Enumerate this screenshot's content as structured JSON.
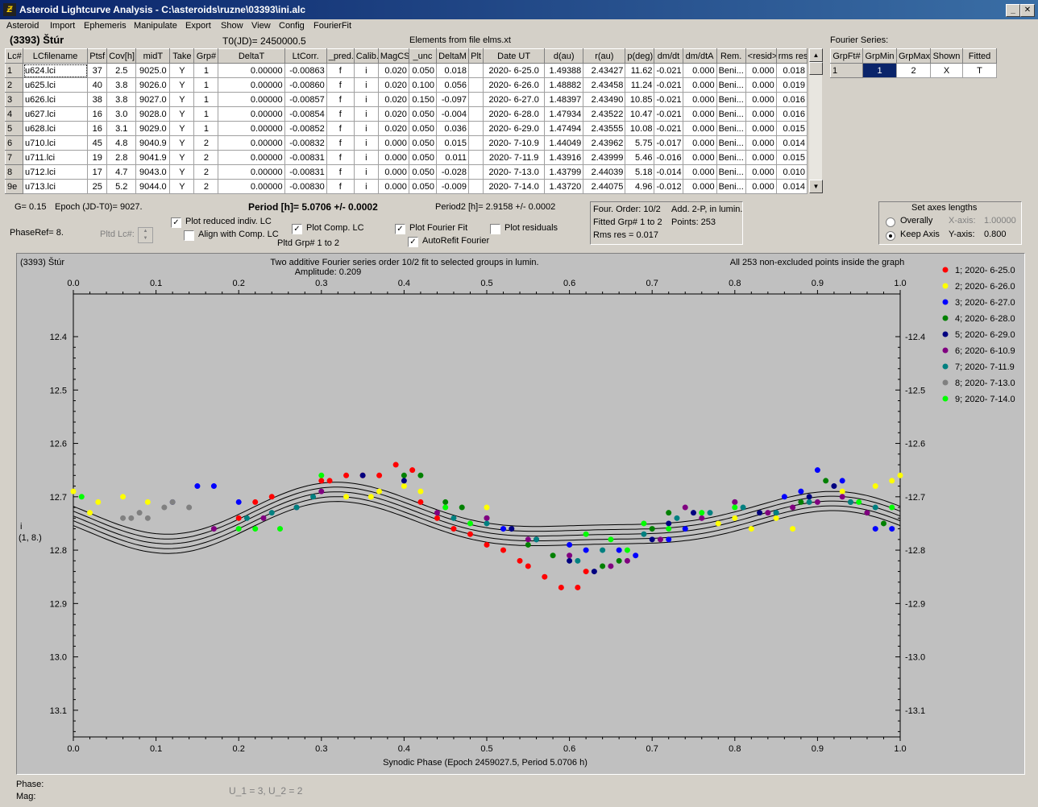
{
  "window": {
    "title": "Asteroid Lightcurve Analysis - C:\\asteroids\\ruzne\\03393\\ini.alc",
    "app_icon": "app-icon"
  },
  "menu": [
    "Asteroid",
    "Import",
    "Ephemeris",
    "Manipulate",
    "Export",
    "Show",
    "View",
    "Config",
    "FourierFit"
  ],
  "header": {
    "asteroid": "(3393) Štúr",
    "t0": "T0(JD)= 2450000.5",
    "elements": "Elements from file elms.xt"
  },
  "table": {
    "columns": [
      "Lc#",
      "LCfilename",
      "Ptsf",
      "Cov[h]",
      "midT",
      "Take",
      "Grp#",
      "DeltaT",
      "LtCorr.",
      "_pred.",
      "Calib.",
      "MagCS",
      "_unc",
      "DeltaM",
      "Plt",
      "Date UT",
      "d(au)",
      "r(au)",
      "p(deg)",
      "dm/dt",
      "dm/dtA",
      "Rem.",
      "<resid>",
      "rms res"
    ],
    "rows": [
      [
        "1",
        "u624.lci",
        "37",
        "2.5",
        "9025.0",
        "Y",
        "1",
        "0.00000",
        "-0.00863",
        "f",
        "i",
        "0.020",
        "0.050",
        "0.018",
        "",
        "2020- 6-25.0",
        "1.49388",
        "2.43427",
        "11.62",
        "-0.021",
        "0.000",
        "Beni...",
        "0.000",
        "0.018"
      ],
      [
        "2",
        "u625.lci",
        "40",
        "3.8",
        "9026.0",
        "Y",
        "1",
        "0.00000",
        "-0.00860",
        "f",
        "i",
        "0.020",
        "0.100",
        "0.056",
        "",
        "2020- 6-26.0",
        "1.48882",
        "2.43458",
        "11.24",
        "-0.021",
        "0.000",
        "Beni...",
        "0.000",
        "0.019"
      ],
      [
        "3",
        "u626.lci",
        "38",
        "3.8",
        "9027.0",
        "Y",
        "1",
        "0.00000",
        "-0.00857",
        "f",
        "i",
        "0.020",
        "0.150",
        "-0.097",
        "",
        "2020- 6-27.0",
        "1.48397",
        "2.43490",
        "10.85",
        "-0.021",
        "0.000",
        "Beni...",
        "0.000",
        "0.016"
      ],
      [
        "4",
        "u627.lci",
        "16",
        "3.0",
        "9028.0",
        "Y",
        "1",
        "0.00000",
        "-0.00854",
        "f",
        "i",
        "0.020",
        "0.050",
        "-0.004",
        "",
        "2020- 6-28.0",
        "1.47934",
        "2.43522",
        "10.47",
        "-0.021",
        "0.000",
        "Beni...",
        "0.000",
        "0.016"
      ],
      [
        "5",
        "u628.lci",
        "16",
        "3.1",
        "9029.0",
        "Y",
        "1",
        "0.00000",
        "-0.00852",
        "f",
        "i",
        "0.020",
        "0.050",
        "0.036",
        "",
        "2020- 6-29.0",
        "1.47494",
        "2.43555",
        "10.08",
        "-0.021",
        "0.000",
        "Beni...",
        "0.000",
        "0.015"
      ],
      [
        "6",
        "u710.lci",
        "45",
        "4.8",
        "9040.9",
        "Y",
        "2",
        "0.00000",
        "-0.00832",
        "f",
        "i",
        "0.000",
        "0.050",
        "0.015",
        "",
        "2020- 7-10.9",
        "1.44049",
        "2.43962",
        "5.75",
        "-0.017",
        "0.000",
        "Beni...",
        "0.000",
        "0.014"
      ],
      [
        "7",
        "u711.lci",
        "19",
        "2.8",
        "9041.9",
        "Y",
        "2",
        "0.00000",
        "-0.00831",
        "f",
        "i",
        "0.000",
        "0.050",
        "0.011",
        "",
        "2020- 7-11.9",
        "1.43916",
        "2.43999",
        "5.46",
        "-0.016",
        "0.000",
        "Beni...",
        "0.000",
        "0.015"
      ],
      [
        "8",
        "u712.lci",
        "17",
        "4.7",
        "9043.0",
        "Y",
        "2",
        "0.00000",
        "-0.00831",
        "f",
        "i",
        "0.000",
        "0.050",
        "-0.028",
        "",
        "2020- 7-13.0",
        "1.43799",
        "2.44039",
        "5.18",
        "-0.014",
        "0.000",
        "Beni...",
        "0.000",
        "0.010"
      ],
      [
        "9e",
        "u713.lci",
        "25",
        "5.2",
        "9044.0",
        "Y",
        "2",
        "0.00000",
        "-0.00830",
        "f",
        "i",
        "0.000",
        "0.050",
        "-0.009",
        "",
        "2020- 7-14.0",
        "1.43720",
        "2.44075",
        "4.96",
        "-0.012",
        "0.000",
        "Beni...",
        "0.000",
        "0.014"
      ]
    ]
  },
  "fourier": {
    "label": "Fourier Series:",
    "columns": [
      "GrpFt#",
      "GrpMin",
      "GrpMax",
      "Shown",
      "Fitted"
    ],
    "row": [
      "1",
      "1",
      "2",
      "X",
      "T"
    ]
  },
  "controls": {
    "g": "G= 0.15",
    "epoch": "Epoch (JD-T0)= 9027.",
    "phaseref": "PhaseRef= 8.",
    "pltd_lc": "Pltd Lc#:",
    "period": "Period [h]= 5.0706 +/- 0.0002",
    "period2": "Period2 [h]= 2.9158 +/- 0.0002",
    "plot_reduced": "Plot reduced indiv. LC",
    "align_comp": "Align with Comp. LC",
    "plot_comp": "Plot Comp. LC",
    "pltd_grp": "Pltd Grp#  1   to   2",
    "plot_fourier": "Plot Fourier Fit",
    "autorefit": "AutoRefit Fourier",
    "plot_residuals": "Plot residuals",
    "plot_reduced_checked": true,
    "align_comp_checked": false,
    "plot_comp_checked": true,
    "plot_fourier_checked": true,
    "autorefit_checked": true,
    "plot_residuals_checked": false
  },
  "fitinfo": {
    "order": "Four. Order: 10/2",
    "add": "Add. 2-P, in lumin.",
    "fitted": "Fitted Grp# 1 to 2",
    "points": "Points: 253",
    "rms": "Rms res      = 0.017"
  },
  "axes_panel": {
    "title": "Set axes lengths",
    "overally": "Overally",
    "keep": "Keep Axis",
    "xaxis_label": "X-axis:",
    "xaxis_val": "1.00000",
    "yaxis_label": "Y-axis:",
    "yaxis_val": "0.800",
    "selected": "Keep Axis"
  },
  "plot": {
    "name": "(3393) Štúr",
    "title": "Two additive Fourier series order 10/2 fit to selected groups in lumin.",
    "amplitude": "Amplitude: 0.209",
    "note": "All 253 non-excluded points inside the graph",
    "ylabel": "i",
    "ylabel2": "(1, 8.)",
    "xlabel": "Synodic Phase (Epoch 2459027.5, Period 5.0706 h)",
    "x_ticks": [
      "0.0",
      "0.1",
      "0.2",
      "0.3",
      "0.4",
      "0.5",
      "0.6",
      "0.7",
      "0.8",
      "0.9",
      "1.0"
    ],
    "y_ticks": [
      "12.4",
      "12.5",
      "12.6",
      "12.7",
      "12.8",
      "12.9",
      "13.0",
      "13.1"
    ]
  },
  "chart_data": {
    "type": "scatter",
    "title": "Two additive Fourier series order 10/2 fit to selected groups in lumin.",
    "xlabel": "Synodic Phase (Epoch 2459027.5, Period 5.0706 h)",
    "ylabel": "i",
    "xlim": [
      0.0,
      1.0
    ],
    "ylim": [
      12.32,
      13.15
    ],
    "y_inverted": true,
    "grid": false,
    "legend_position": "right",
    "series": [
      {
        "name": "1; 2020- 6-25.0",
        "color": "#ff0000",
        "x": [
          0.2,
          0.22,
          0.24,
          0.3,
          0.31,
          0.33,
          0.35,
          0.37,
          0.39,
          0.41,
          0.42,
          0.44,
          0.46,
          0.48,
          0.5,
          0.52,
          0.54,
          0.55,
          0.57,
          0.59,
          0.61,
          0.62
        ],
        "y": [
          12.74,
          12.71,
          12.7,
          12.67,
          12.67,
          12.66,
          12.66,
          12.66,
          12.64,
          12.65,
          12.71,
          12.74,
          12.76,
          12.77,
          12.79,
          12.8,
          12.82,
          12.83,
          12.85,
          12.87,
          12.87,
          12.84
        ]
      },
      {
        "name": "2; 2020- 6-26.0",
        "color": "#ffff00",
        "x": [
          0.0,
          0.02,
          0.03,
          0.06,
          0.09,
          0.12,
          0.33,
          0.36,
          0.37,
          0.4,
          0.42,
          0.5,
          0.78,
          0.8,
          0.82,
          0.85,
          0.87,
          0.93,
          0.97,
          0.99,
          1.0
        ],
        "y": [
          12.69,
          12.73,
          12.71,
          12.7,
          12.71,
          12.71,
          12.7,
          12.7,
          12.69,
          12.68,
          12.69,
          12.72,
          12.75,
          12.74,
          12.76,
          12.74,
          12.76,
          12.69,
          12.68,
          12.67,
          12.66
        ]
      },
      {
        "name": "3; 2020- 6-27.0",
        "color": "#0000ff",
        "x": [
          0.12,
          0.15,
          0.17,
          0.2,
          0.52,
          0.6,
          0.62,
          0.66,
          0.68,
          0.72,
          0.74,
          0.86,
          0.88,
          0.9,
          0.93,
          0.97,
          0.99
        ],
        "y": [
          12.71,
          12.68,
          12.68,
          12.71,
          12.76,
          12.79,
          12.8,
          12.8,
          12.81,
          12.78,
          12.76,
          12.7,
          12.69,
          12.65,
          12.67,
          12.76,
          12.76
        ]
      },
      {
        "name": "4; 2020- 6-28.0",
        "color": "#008000",
        "x": [
          0.4,
          0.42,
          0.45,
          0.47,
          0.55,
          0.58,
          0.64,
          0.66,
          0.7,
          0.72,
          0.88,
          0.91,
          0.94,
          0.96,
          0.98
        ],
        "y": [
          12.66,
          12.66,
          12.71,
          12.72,
          12.79,
          12.81,
          12.83,
          12.82,
          12.76,
          12.73,
          12.71,
          12.67,
          12.71,
          12.73,
          12.75
        ]
      },
      {
        "name": "5; 2020- 6-29.0",
        "color": "#000080",
        "x": [
          0.35,
          0.4,
          0.5,
          0.53,
          0.56,
          0.6,
          0.63,
          0.7,
          0.72,
          0.75,
          0.8,
          0.83,
          0.85,
          0.89,
          0.92
        ],
        "y": [
          12.66,
          12.67,
          12.74,
          12.76,
          12.78,
          12.82,
          12.84,
          12.78,
          12.75,
          12.73,
          12.71,
          12.73,
          12.73,
          12.7,
          12.68
        ]
      },
      {
        "name": "6; 2020- 6-10.9",
        "color": "#800080",
        "x": [
          0.17,
          0.23,
          0.27,
          0.3,
          0.44,
          0.5,
          0.55,
          0.6,
          0.65,
          0.67,
          0.71,
          0.74,
          0.76,
          0.8,
          0.84,
          0.87,
          0.9,
          0.93,
          0.96
        ],
        "y": [
          12.76,
          12.74,
          12.72,
          12.69,
          12.73,
          12.74,
          12.78,
          12.81,
          12.83,
          12.82,
          12.78,
          12.72,
          12.74,
          12.71,
          12.73,
          12.72,
          12.71,
          12.7,
          12.73
        ]
      },
      {
        "name": "7; 2020- 7-11.9",
        "color": "#008080",
        "x": [
          0.21,
          0.24,
          0.27,
          0.29,
          0.46,
          0.5,
          0.56,
          0.61,
          0.64,
          0.69,
          0.73,
          0.77,
          0.81,
          0.85,
          0.89,
          0.94,
          0.97
        ],
        "y": [
          12.74,
          12.73,
          12.72,
          12.7,
          12.74,
          12.75,
          12.78,
          12.82,
          12.8,
          12.77,
          12.74,
          12.73,
          12.72,
          12.73,
          12.71,
          12.71,
          12.72
        ]
      },
      {
        "name": "8; 2020- 7-13.0",
        "color": "#808080",
        "x": [
          0.06,
          0.07,
          0.08,
          0.09,
          0.11,
          0.12,
          0.14
        ],
        "y": [
          12.74,
          12.74,
          12.73,
          12.74,
          12.72,
          12.71,
          12.72
        ]
      },
      {
        "name": "9; 2020- 7-14.0",
        "color": "#00ff00",
        "x": [
          0.01,
          0.2,
          0.22,
          0.25,
          0.3,
          0.45,
          0.48,
          0.62,
          0.65,
          0.67,
          0.69,
          0.72,
          0.76,
          0.8,
          0.95,
          0.99
        ],
        "y": [
          12.7,
          12.76,
          12.76,
          12.76,
          12.66,
          12.72,
          12.75,
          12.77,
          12.78,
          12.8,
          12.75,
          12.76,
          12.73,
          12.72,
          12.71,
          12.72
        ]
      }
    ]
  }
}
